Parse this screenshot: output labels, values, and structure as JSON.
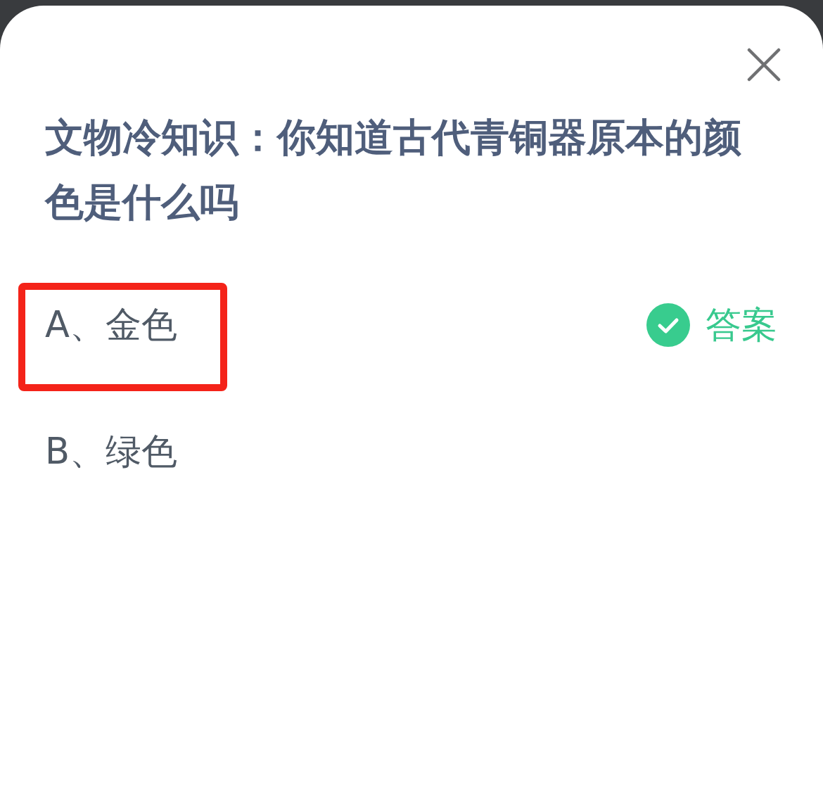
{
  "question": {
    "title": "文物冷知识：你知道古代青铜器原本的颜色是什么吗",
    "options": [
      {
        "label": "A、金色",
        "highlighted": true,
        "correct": true,
        "answer_label": "答案"
      },
      {
        "label": "B、绿色",
        "highlighted": false,
        "correct": false
      }
    ]
  }
}
